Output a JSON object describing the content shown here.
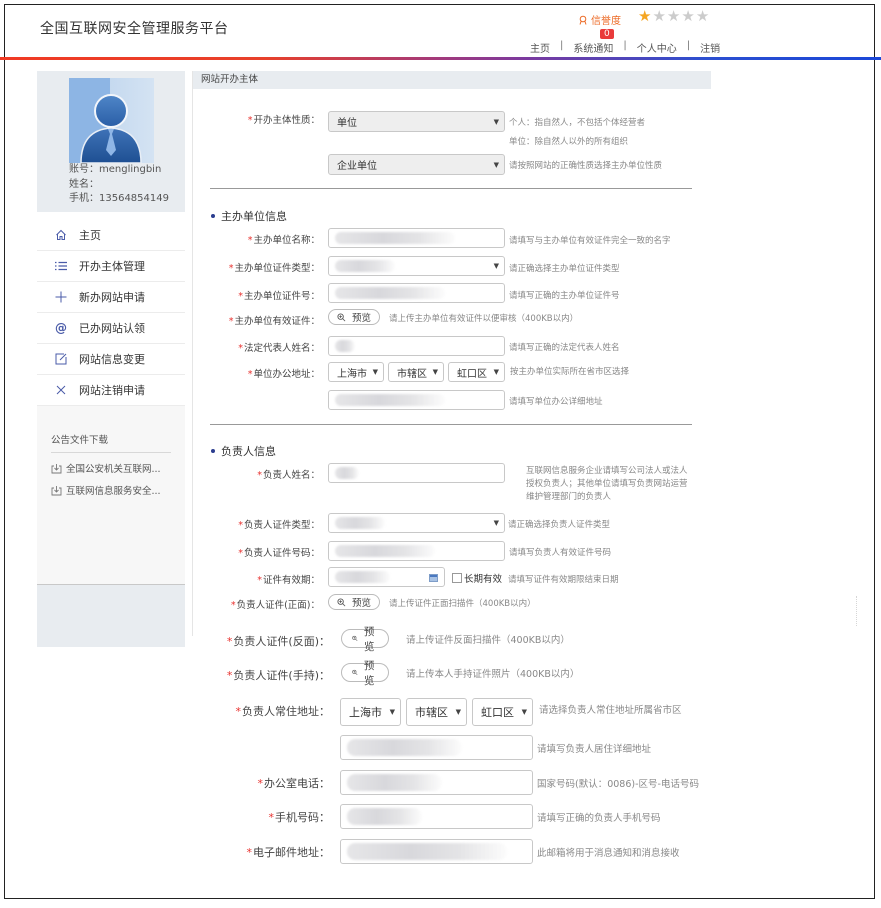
{
  "header": {
    "site_title": "全国互联网安全管理服务平台",
    "credit_label": "信誉度",
    "credit_stars_filled": 1,
    "credit_stars_total": 5,
    "notification_count": "0",
    "nav": [
      "主页",
      "系统通知",
      "个人中心",
      "注销"
    ],
    "nav_separator": "|"
  },
  "profile": {
    "account_label": "账号：",
    "account": "menglingbin",
    "name_label": "姓名：",
    "name": "",
    "phone_label": "手机：",
    "phone": "13564854149"
  },
  "sidebar": {
    "items": [
      {
        "label": "主页",
        "icon": "home-icon"
      },
      {
        "label": "开办主体管理",
        "icon": "list-icon"
      },
      {
        "label": "新办网站申请",
        "icon": "plus-icon"
      },
      {
        "label": "已办网站认领",
        "icon": "at-icon"
      },
      {
        "label": "网站信息变更",
        "icon": "edit-icon"
      },
      {
        "label": "网站注销申请",
        "icon": "close-icon"
      }
    ],
    "downloads_title": "公告文件下载",
    "downloads": [
      "全国公安机关互联网...",
      "互联网信息服务安全..."
    ]
  },
  "form": {
    "panel_title": "网站开办主体",
    "subject_nature": {
      "label": "开办主体性质：",
      "value": "单位",
      "hint_1": "个人：指自然人，不包括个体经营者",
      "hint_2": "单位：除自然人以外的所有组织",
      "sub_value": "企业单位",
      "sub_hint": "请按照网站的正确性质选择主办单位性质"
    },
    "org_section": "主办单位信息",
    "org_name": {
      "label": "主办单位名称：",
      "hint": "请填写与主办单位有效证件完全一致的名字"
    },
    "org_cert_type": {
      "label": "主办单位证件类型：",
      "hint": "请正确选择主办单位证件类型"
    },
    "org_cert_no": {
      "label": "主办单位证件号：",
      "hint": "请填写正确的主办单位证件号"
    },
    "org_cert_file": {
      "label": "主办单位有效证件：",
      "button": "预览",
      "hint": "请上传主办单位有效证件以便审核（400KB以内）"
    },
    "legal_rep": {
      "label": "法定代表人姓名：",
      "hint": "请填写正确的法定代表人姓名"
    },
    "org_address": {
      "label": "单位办公地址：",
      "province": "上海市",
      "city": "市辖区",
      "district": "虹口区",
      "hint": "按主办单位实际所在省市区选择",
      "detail_hint": "请填写单位办公详细地址"
    },
    "person_section": "负责人信息",
    "person_name": {
      "label": "负责人姓名：",
      "hint": "互联网信息服务企业请填写公司法人或法人授权负责人；其他单位请填写负责网站运营维护管理部门的负责人"
    },
    "person_cert_type": {
      "label": "负责人证件类型：",
      "hint": "请正确选择负责人证件类型"
    },
    "person_cert_no": {
      "label": "负责人证件号码：",
      "hint": "请填写负责人有效证件号码"
    },
    "cert_validity": {
      "label": "证件有效期：",
      "long_term_label": "长期有效",
      "hint": "请填写证件有效期限结束日期"
    },
    "cert_front": {
      "label": "负责人证件(正面)：",
      "button": "预览",
      "hint": "请上传证件正面扫描件（400KB以内）"
    },
    "cert_back": {
      "label": "负责人证件(反面)：",
      "button": "预览",
      "hint": "请上传证件反面扫描件（400KB以内）"
    },
    "cert_hand": {
      "label": "负责人证件(手持)：",
      "button": "预览",
      "hint": "请上传本人手持证件照片（400KB以内）"
    },
    "person_address": {
      "label": "负责人常住地址：",
      "province": "上海市",
      "city": "市辖区",
      "district": "虹口区",
      "hint": "请选择负责人常住地址所属省市区",
      "detail_hint": "请填写负责人居住详细地址"
    },
    "office_phone": {
      "label": "办公室电话：",
      "hint": "国家号码(默认：0086)-区号-电话号码"
    },
    "mobile": {
      "label": "手机号码：",
      "hint": "请填写正确的负责人手机号码"
    },
    "email": {
      "label": "电子邮件地址：",
      "hint": "此邮箱将用于消息通知和消息接收"
    },
    "required_mark": "*"
  },
  "colors": {
    "accent_orange": "#ec6a25",
    "required_red": "#e8322f",
    "icon_blue": "#4a5ba8",
    "star_gold": "#f5a623"
  }
}
